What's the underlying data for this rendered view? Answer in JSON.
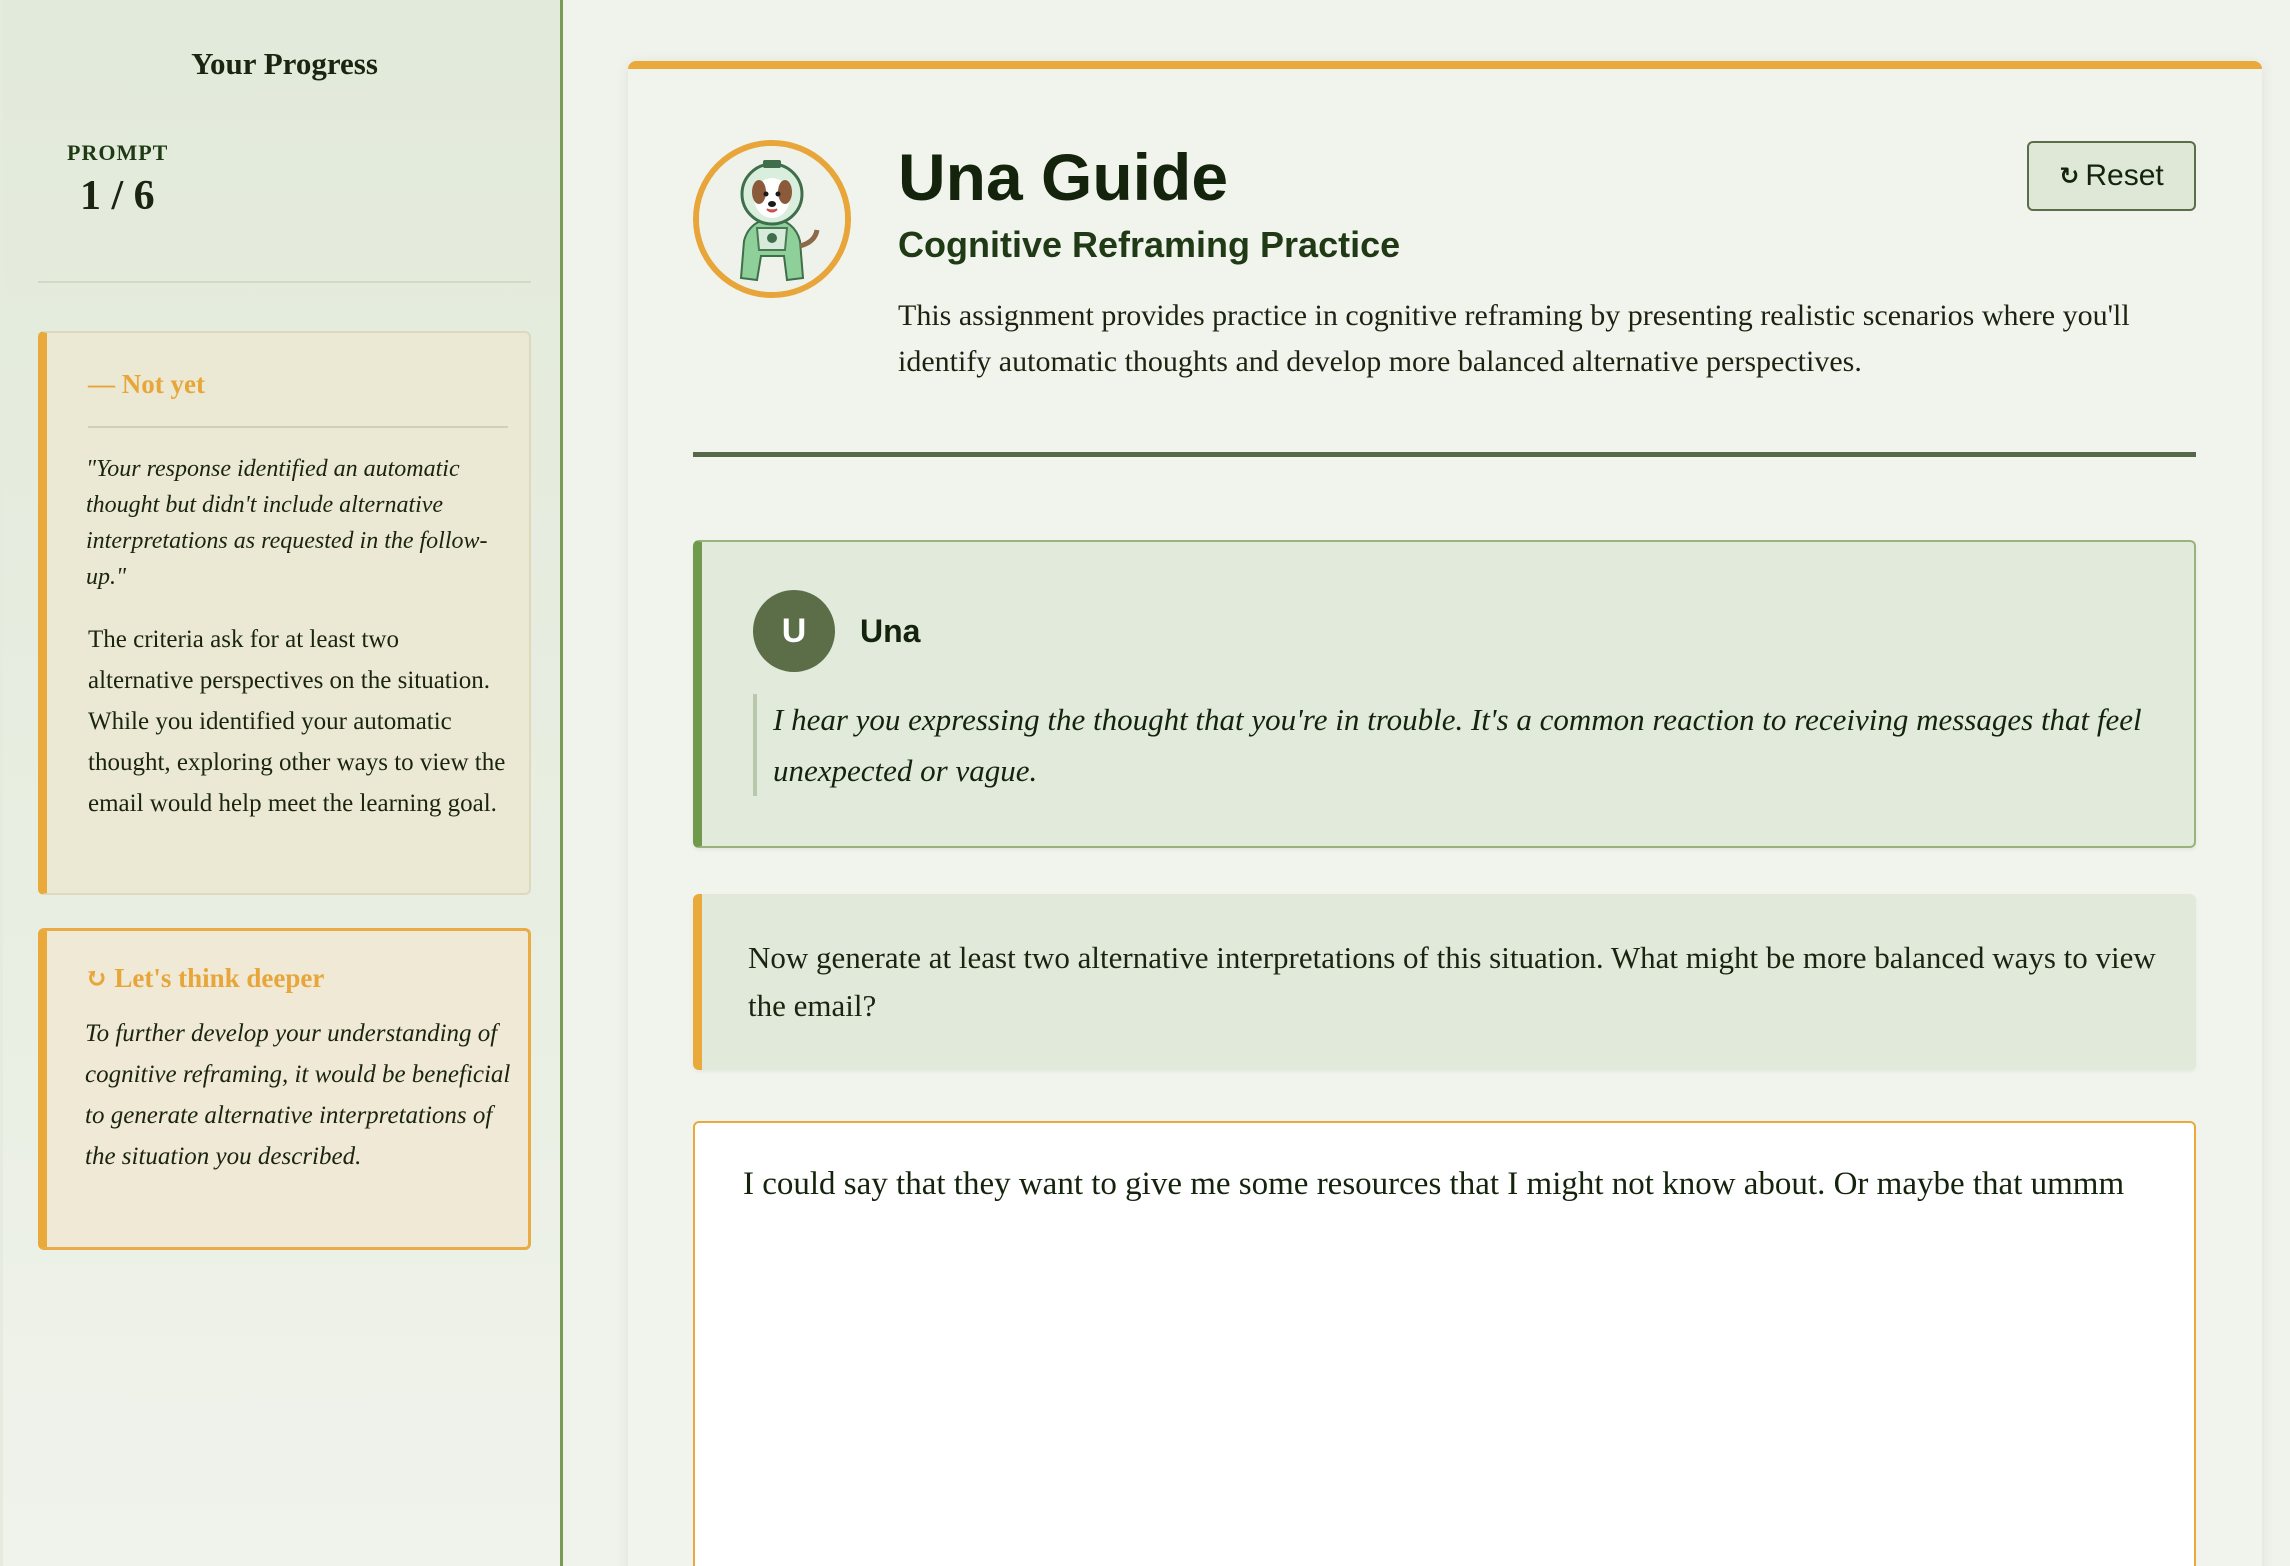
{
  "sidebar": {
    "title": "Your Progress",
    "prompt_label": "PROMPT",
    "prompt_count": "1 / 6",
    "feedback": {
      "status": "— Not yet",
      "quote": "\"Your response identified an automatic thought but didn't include alternative interpretations as requested in the follow-up.\"",
      "body": "The criteria ask for at least two alternative perspectives on the situation. While you identified your automatic thought, exploring other ways to view the email would help meet the learning goal."
    },
    "think_deeper": {
      "title": "↻ Let's think deeper",
      "body": "To further develop your understanding of cognitive reframing, it would be beneficial to generate alternative interpretations of the situation you described."
    }
  },
  "header": {
    "title": "Una Guide",
    "subtitle": "Cognitive Reframing Practice",
    "description": "This assignment provides practice in cognitive reframing by presenting realistic scenarios where you'll identify automatic thoughts and develop more balanced alternative perspectives.",
    "reset_label": "Reset",
    "reset_icon": "↻"
  },
  "message": {
    "avatar_initial": "U",
    "author": "Una",
    "text": "I hear you expressing the thought that you're in trouble. It's a common reaction to receiving messages that feel unexpected or vague."
  },
  "prompt": {
    "text": "Now generate at least two alternative interpretations of this situation. What might be more balanced ways to view the email?"
  },
  "response": {
    "value": "I could say that they want to give me some resources that I might not know about. Or maybe that ummm"
  },
  "colors": {
    "accent": "#eaa93b",
    "primary_green": "#5b6e48",
    "sidebar_border": "#7a9a55"
  },
  "icons": {
    "avatar": "astronaut-dog-icon",
    "reset": "refresh-icon"
  }
}
